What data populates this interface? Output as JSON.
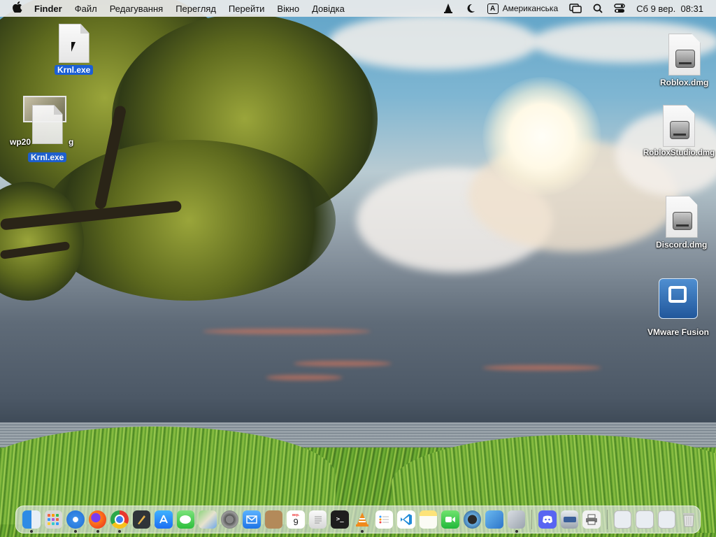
{
  "menubar": {
    "apple": "",
    "app": "Finder",
    "items": [
      "Файл",
      "Редагування",
      "Перегляд",
      "Перейти",
      "Вікно",
      "Довідка"
    ],
    "input_badge": "A",
    "input_source": "Американська",
    "datetime": "Сб 9 вер.  08:31"
  },
  "desktop": {
    "krnl_top": "Krnl.exe",
    "wp_file": "wp2066…jpg",
    "wp_prefix": "wp20",
    "wp_suffix": "g",
    "krnl_drag": "Krnl.exe",
    "roblox": "Roblox.dmg",
    "roblox_studio": "RobloxStudio.dmg",
    "discord": "Discord.dmg",
    "vmware": "VMware Fusion"
  },
  "dock": {
    "calendar_month": "вер.",
    "calendar_day": "9",
    "apps": [
      "finder-icon",
      "launchpad-icon",
      "safari-icon",
      "firefox-icon",
      "chrome-icon",
      "xcode-brush-icon",
      "app-store-icon",
      "messages-icon",
      "maps-icon",
      "system-settings-icon",
      "mail-icon",
      "contacts-icon",
      "calendar-icon",
      "textedit-icon",
      "terminal-icon",
      "vlc-icon",
      "reminders-icon",
      "vscode-icon",
      "notes-icon",
      "facetime-icon",
      "quicktime-icon",
      "window-app-icon",
      "preview-icon",
      "discord-icon",
      "scanner-icon",
      "printer-icon",
      "recent-window-1-icon",
      "recent-window-2-icon",
      "recent-window-3-icon",
      "trash-icon"
    ]
  }
}
